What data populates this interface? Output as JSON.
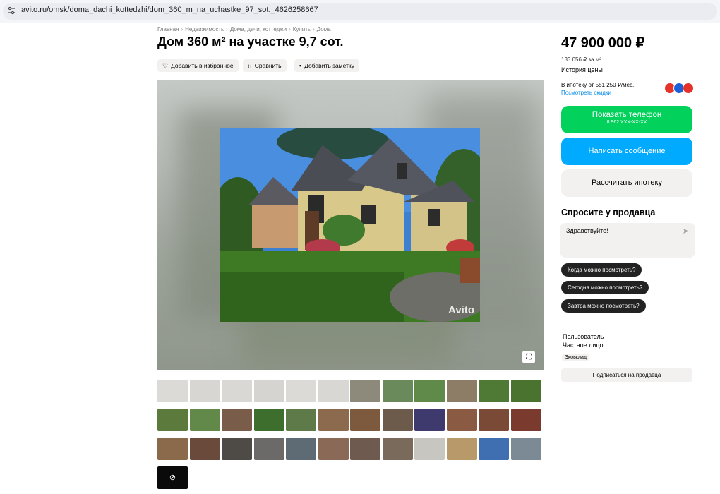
{
  "browser": {
    "url": "avito.ru/omsk/doma_dachi_kottedzhi/dom_360_m_na_uchastke_97_sot._4626258667"
  },
  "breadcrumbs": [
    "Главная",
    "Недвижимость",
    "Дома, дачи, коттеджи",
    "Купить",
    "Дома"
  ],
  "title": "Дом 360 м² на участке 9,7 сот.",
  "actions": {
    "favorite": "Добавить в избранное",
    "compare": "Сравнить",
    "note": "Добавить заметку"
  },
  "gallery": {
    "watermark": "Avito",
    "thumbnail_count": 37
  },
  "price": "47 900 000 ₽",
  "price_per_m2": "133 056 ₽ за м²",
  "price_history": "История цены",
  "mortgage": "В ипотеку от 551 250 ₽/мес.",
  "discounts": "Посмотреть скидки",
  "buttons": {
    "show_phone": "Показать телефон",
    "phone_masked": "8 962 XXX-XX-XX",
    "write": "Написать сообщение",
    "mortgage_calc": "Рассчитать ипотеку"
  },
  "ask_seller": {
    "title": "Спросите у продавца",
    "message": "Здравствуйте!",
    "chips": [
      "Когда можно посмотреть?",
      "Сегодня можно посмотреть?",
      "Завтра можно посмотреть?"
    ]
  },
  "seller": {
    "name": "Пользователь",
    "type": "Частное лицо",
    "badge": "Эковклад",
    "subscribe": "Подписаться на продавца"
  },
  "colors": {
    "green": "#02d15c",
    "blue": "#00aaff",
    "link": "#0a8de5"
  }
}
